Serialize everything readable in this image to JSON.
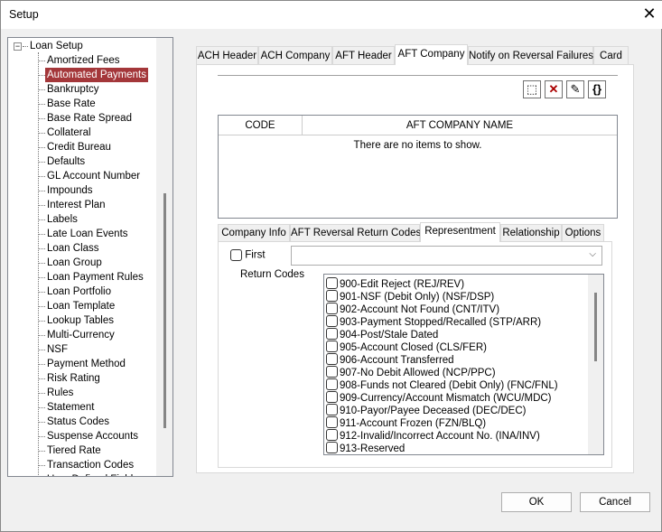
{
  "window": {
    "title": "Setup",
    "close_icon": "close-icon"
  },
  "tree": {
    "root": "Loan Setup",
    "selected": "Automated Payments",
    "items": [
      "Amortized Fees",
      "Automated Payments",
      "Bankruptcy",
      "Base Rate",
      "Base Rate Spread",
      "Collateral",
      "Credit Bureau",
      "Defaults",
      "GL Account Number",
      "Impounds",
      "Interest Plan",
      "Labels",
      "Late Loan Events",
      "Loan Class",
      "Loan Group",
      "Loan Payment Rules",
      "Loan Portfolio",
      "Loan Template",
      "Lookup Tables",
      "Multi-Currency",
      "NSF",
      "Payment Method",
      "Risk Rating",
      "Rules",
      "Statement",
      "Status Codes",
      "Suspense Accounts",
      "Tiered Rate",
      "Transaction Codes",
      "User Defined Fields"
    ]
  },
  "tabs": [
    "ACH Header",
    "ACH Company",
    "AFT Header",
    "AFT Company",
    "Notify on Reversal Failures",
    "Card"
  ],
  "active_tab": "AFT Company",
  "toolbar": [
    "new-icon",
    "delete-icon",
    "edit-icon",
    "braces-icon"
  ],
  "grid": {
    "columns": [
      "CODE",
      "AFT COMPANY NAME"
    ],
    "empty_text": "There are no items to show."
  },
  "subtabs": [
    "Company Info",
    "AFT Reversal Return Codes",
    "Representment",
    "Relationship",
    "Options"
  ],
  "active_subtab": "Representment",
  "representment": {
    "first_label": "First",
    "first_checked": false,
    "dropdown_value": "",
    "return_codes_label": "Return Codes",
    "codes": [
      "900-Edit Reject (REJ/REV)",
      "901-NSF (Debit Only) (NSF/DSP)",
      "902-Account Not Found (CNT/ITV)",
      "903-Payment Stopped/Recalled (STP/ARR)",
      "904-Post/Stale Dated",
      "905-Account Closed (CLS/FER)",
      "906-Account Transferred",
      "907-No Debit Allowed (NCP/PPC)",
      "908-Funds not Cleared (Debit Only) (FNC/FNL)",
      "909-Currency/Account Mismatch (WCU/MDC)",
      "910-Payor/Payee Deceased (DEC/DEC)",
      "911-Account Frozen (FZN/BLQ)",
      "912-Invalid/Incorrect Account No. (INA/INV)",
      "913-Reserved"
    ]
  },
  "buttons": {
    "ok": "OK",
    "cancel": "Cancel"
  },
  "colors": {
    "selection": "#a4373a"
  }
}
